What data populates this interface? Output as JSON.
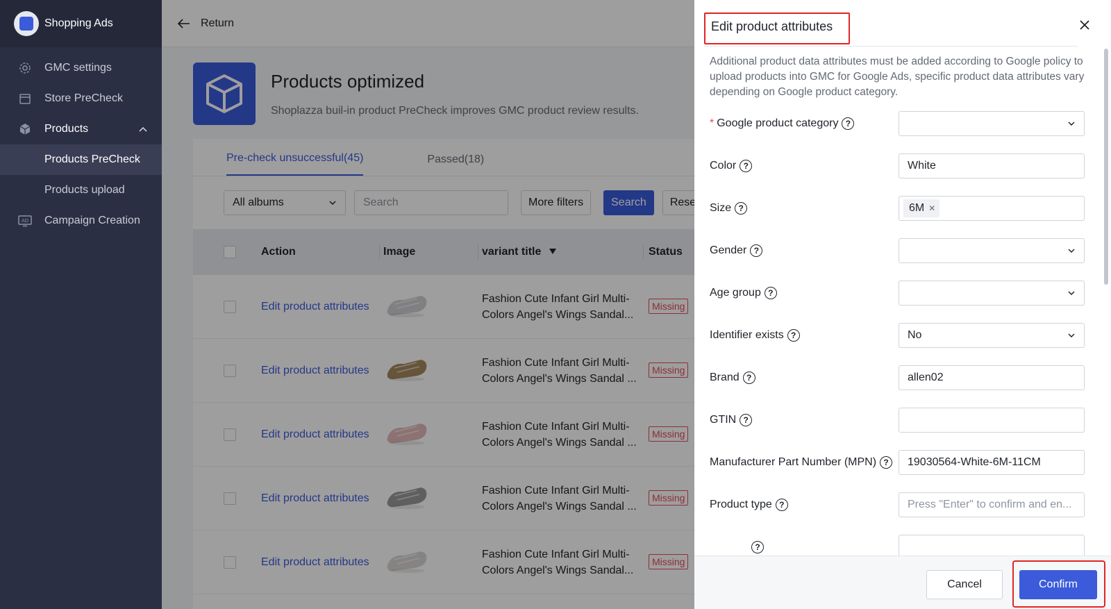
{
  "app": {
    "name": "Shopping Ads"
  },
  "sidebar": {
    "items": [
      {
        "label": "GMC settings",
        "icon": "gear-icon"
      },
      {
        "label": "Store PreCheck",
        "icon": "store-icon"
      },
      {
        "label": "Products",
        "icon": "box-icon"
      },
      {
        "label": "Products PreCheck"
      },
      {
        "label": "Products upload"
      },
      {
        "label": "Campaign Creation",
        "icon": "ad-icon"
      }
    ]
  },
  "topbar": {
    "return_label": "Return"
  },
  "hero": {
    "title": "Products optimized",
    "subtitle": "Shoplazza buil-in product PreCheck improves GMC product review results."
  },
  "tabs": [
    {
      "label": "Pre-check unsuccessful(45)"
    },
    {
      "label": "Passed(18)"
    }
  ],
  "filters": {
    "album": "All albums",
    "search_placeholder": "Search",
    "more_filters": "More filters",
    "search_button": "Search",
    "reset_button": "Reset"
  },
  "table": {
    "headers": [
      "Action",
      "Image",
      "variant title",
      "Status"
    ],
    "rows": [
      {
        "action": "Edit product attributes",
        "title": "Fashion Cute Infant Girl Multi-Colors Angel's Wings Sandal...",
        "status": "Missing",
        "shoe_color": "#cfcfd2"
      },
      {
        "action": "Edit product attributes",
        "title": "Fashion Cute Infant Girl Multi-Colors Angel's Wings Sandal ...",
        "status": "Missing",
        "shoe_color": "#a68a5e"
      },
      {
        "action": "Edit product attributes",
        "title": "Fashion Cute Infant Girl Multi-Colors Angel's Wings Sandal ...",
        "status": "Missing",
        "shoe_color": "#e3b8b8"
      },
      {
        "action": "Edit product attributes",
        "title": "Fashion Cute Infant Girl Multi-Colors Angel's Wings Sandal ...",
        "status": "Missing",
        "shoe_color": "#9a9a9c"
      },
      {
        "action": "Edit product attributes",
        "title": "Fashion Cute Infant Girl Multi-Colors Angel's Wings Sandal...",
        "status": "Missing",
        "shoe_color": "#d8d6d2"
      }
    ]
  },
  "drawer": {
    "title": "Edit product attributes",
    "description": "Additional product data attributes must be added according to Google policy to upload products into GMC for Google Ads, specific product data attributes vary depending on Google product category.",
    "fields": {
      "category": {
        "label": "Google product category",
        "value": ""
      },
      "color": {
        "label": "Color",
        "value": "White"
      },
      "size": {
        "label": "Size",
        "tag": "6M"
      },
      "gender": {
        "label": "Gender",
        "value": ""
      },
      "age_group": {
        "label": "Age group",
        "value": ""
      },
      "identifier_exists": {
        "label": "Identifier exists",
        "value": "No"
      },
      "brand": {
        "label": "Brand",
        "value": "allen02"
      },
      "gtin": {
        "label": "GTIN",
        "value": ""
      },
      "mpn": {
        "label": "Manufacturer Part Number (MPN)",
        "value": "19030564-White-6M-11CM"
      },
      "product_type": {
        "label": "Product type",
        "placeholder": "Press \"Enter\" to confirm and en..."
      }
    },
    "cancel": "Cancel",
    "confirm": "Confirm"
  },
  "colors": {
    "accent": "#3b5bdb",
    "sidebar": "#2b2f44",
    "highlight": "#e02424",
    "danger": "#e34d59"
  }
}
